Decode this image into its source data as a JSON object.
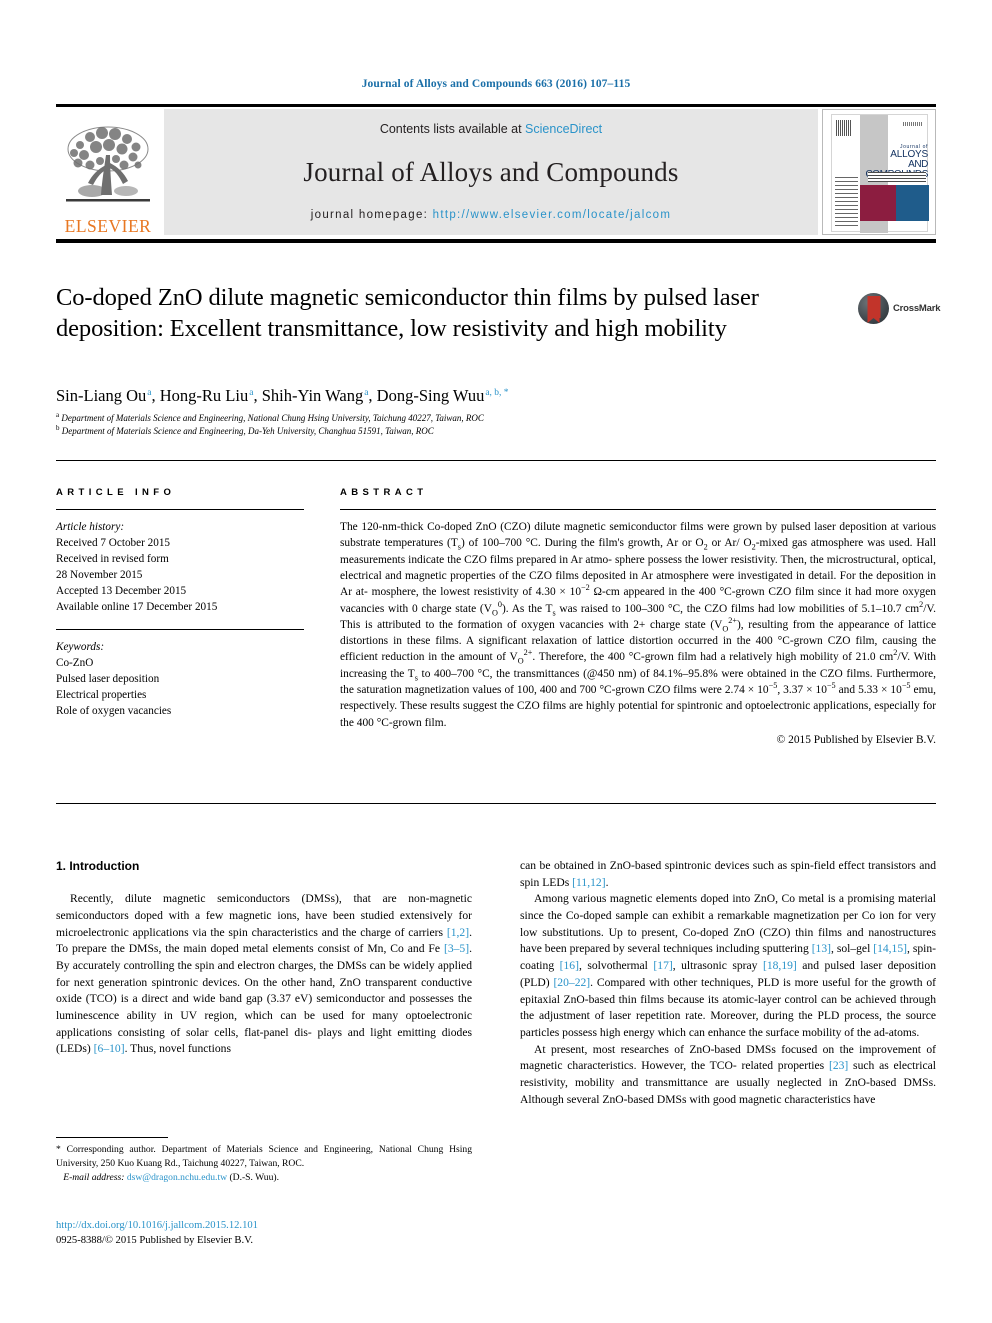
{
  "running_head": "Journal of Alloys and Compounds 663 (2016) 107–115",
  "masthead": {
    "contents_prefix": "Contents lists available at ",
    "contents_link": "ScienceDirect",
    "journal_title": "Journal of Alloys and Compounds",
    "homepage_label": "journal homepage: ",
    "homepage_url": "http://www.elsevier.com/locate/jalcom",
    "publisher_logo_text": "ELSEVIER",
    "cover": {
      "line1": "Journal of",
      "line2": "ALLOYS",
      "line3": "AND COMPOUNDS"
    },
    "colors": {
      "link_blue": "#2a93c9",
      "elsevier_orange": "#E87722",
      "cover_maroon": "#8c1d40",
      "cover_blue": "#1f5c8b",
      "masthead_gray": "#e6e6e6"
    }
  },
  "crossmark": {
    "label": "CrossMark"
  },
  "title": "Co-doped ZnO dilute magnetic semiconductor thin films by pulsed laser deposition: Excellent transmittance, low resistivity and high mobility",
  "authors": [
    {
      "name": "Sin-Liang Ou",
      "marks": "a"
    },
    {
      "name": "Hong-Ru Liu",
      "marks": "a"
    },
    {
      "name": "Shih-Yin Wang",
      "marks": "a"
    },
    {
      "name": "Dong-Sing Wuu",
      "marks": "a, b, *"
    }
  ],
  "affiliations": [
    {
      "mark": "a",
      "text": "Department of Materials Science and Engineering, National Chung Hsing University, Taichung 40227, Taiwan, ROC"
    },
    {
      "mark": "b",
      "text": "Department of Materials Science and Engineering, Da-Yeh University, Changhua 51591, Taiwan, ROC"
    }
  ],
  "article_info": {
    "heading": "ARTICLE INFO",
    "history_label": "Article history:",
    "history": [
      "Received 7 October 2015",
      "Received in revised form",
      "28 November 2015",
      "Accepted 13 December 2015",
      "Available online 17 December 2015"
    ],
    "keywords_label": "Keywords:",
    "keywords": [
      "Co-ZnO",
      "Pulsed laser deposition",
      "Electrical properties",
      "Role of oxygen vacancies"
    ]
  },
  "abstract": {
    "heading": "ABSTRACT",
    "copyright": "© 2015 Published by Elsevier B.V."
  },
  "introduction": {
    "heading": "1. Introduction"
  },
  "footnote": {
    "corresponding": "* Corresponding author. Department of Materials Science and Engineering, National Chung Hsing University, 250 Kuo Kuang Rd., Taichung 40227, Taiwan, ROC.",
    "email_label": "E-mail address:",
    "email": "dsw@dragon.nchu.edu.tw",
    "email_owner": "(D.-S. Wuu)."
  },
  "footer": {
    "doi": "http://dx.doi.org/10.1016/j.jallcom.2015.12.101",
    "issn_line": "0925-8388/© 2015 Published by Elsevier B.V."
  }
}
